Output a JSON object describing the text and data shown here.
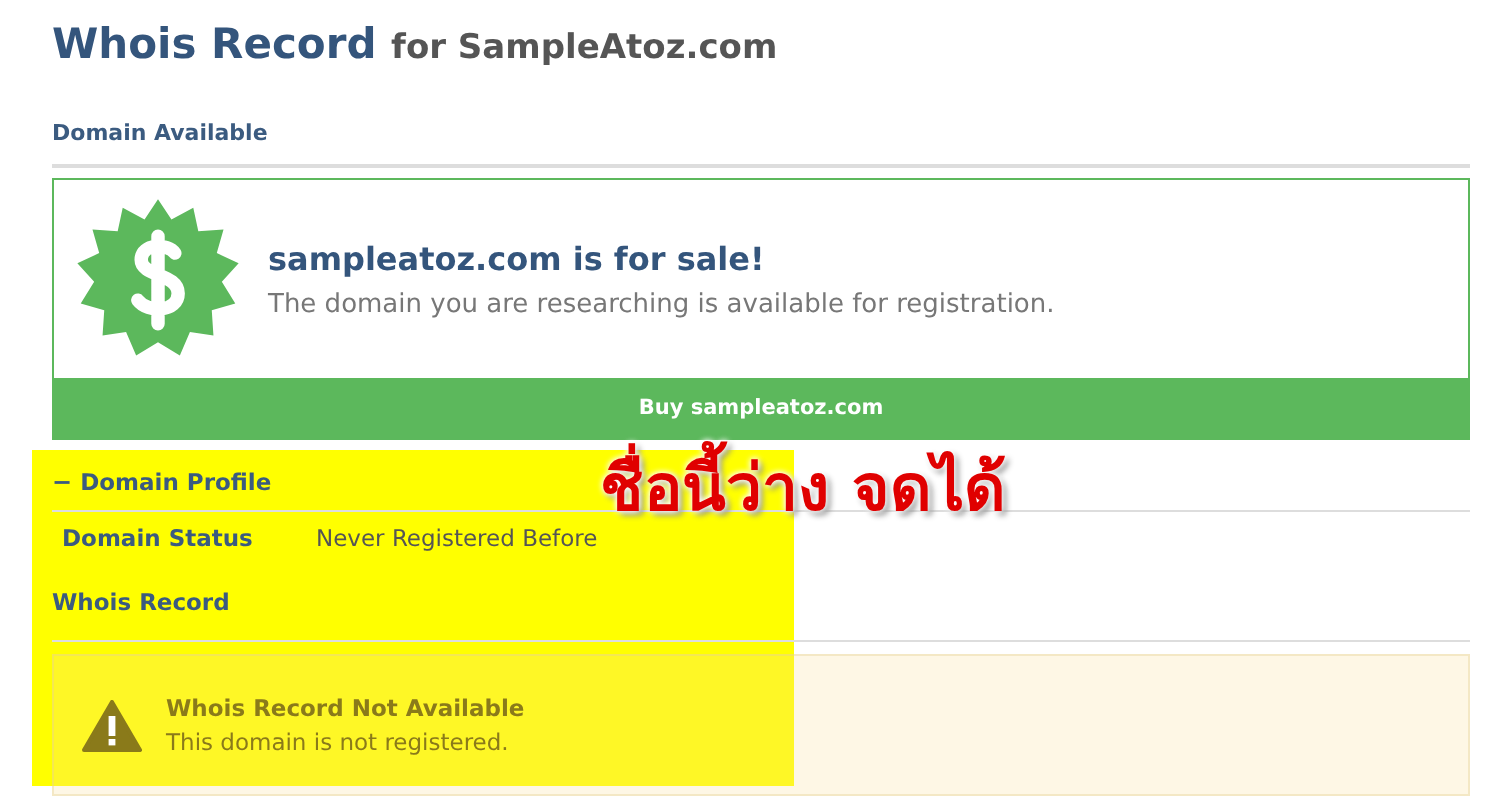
{
  "header": {
    "title": "Whois Record",
    "subtitle": "for SampleAtoz.com"
  },
  "section_label": "Domain Available",
  "sale_card": {
    "headline": "sampleatoz.com is for sale!",
    "description": "The domain you are researching is available for registration.",
    "button": "Buy sampleatoz.com"
  },
  "profile": {
    "toggle": "−",
    "heading": "Domain Profile",
    "rows": [
      {
        "label": "Domain Status",
        "value": "Never Registered Before"
      }
    ]
  },
  "whois_heading": "Whois Record",
  "notice": {
    "title": "Whois Record Not Available",
    "message": "This domain is not registered."
  },
  "annotation": {
    "callout": "ชื่อนี้ว่าง จดได้"
  }
}
